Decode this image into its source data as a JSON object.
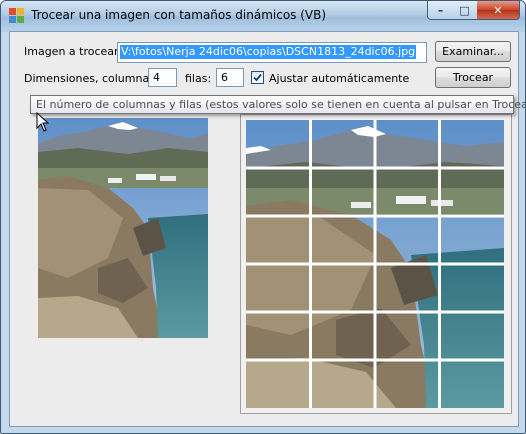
{
  "window": {
    "title": "Trocear una imagen con tamaños dinámicos (VB)",
    "controls": {
      "minimize": "–",
      "maximize": "□",
      "close": "✕"
    }
  },
  "form": {
    "image_label": "Imagen a trocear:",
    "image_path": "V:\\fotos\\Nerja 24dic06\\copias\\DSCN1813_24dic06.jpg",
    "browse_button": "Examinar...",
    "columns_label": "Dimensiones, columnas:",
    "columns_value": "4",
    "rows_label": "filas:",
    "rows_value": "6",
    "auto_adjust_label": "Ajustar automáticamente",
    "auto_adjust_checked": true,
    "split_button": "Trocear"
  },
  "tooltip": {
    "text": "El número de columnas y filas (estos valores solo se tienen en cuenta al pulsar en Trocear)"
  },
  "colors": {
    "title_bar": "#b0cbe4",
    "selection": "#3399ff",
    "close_button": "#c8442b",
    "sea": "#3f7f8a",
    "sky": "#6f9ac8"
  },
  "icons": {
    "app": "app-icon",
    "cursor": "mouse-cursor-icon"
  },
  "grid": {
    "columns": 4,
    "rows": 6
  }
}
